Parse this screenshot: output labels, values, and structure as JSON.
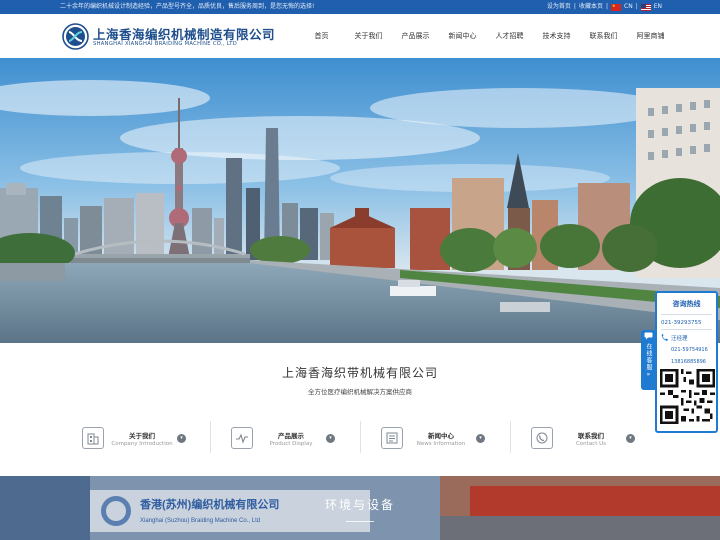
{
  "topbar": {
    "slogan": "二十余年的编织机械设计制造经验，产品型号齐全，品质优良，售后服务周到，是您无悔的选择!",
    "set_home": "设为首页",
    "separator": "|",
    "favorite": "收藏本页",
    "separator2": "|",
    "lang_cn": "CN",
    "separator3": "|",
    "lang_en": "EN"
  },
  "brand": {
    "name_cn": "上海香海编织机械制造有限公司",
    "name_en": "SHANGHAI XIANGHAI BRAIDING MACHINE CO., LTD"
  },
  "nav": {
    "items": [
      {
        "label": "首页"
      },
      {
        "label": "关于我们"
      },
      {
        "label": "产品展示"
      },
      {
        "label": "新闻中心"
      },
      {
        "label": "人才招聘"
      },
      {
        "label": "技术支持"
      },
      {
        "label": "联系我们"
      },
      {
        "label": "阿里商铺"
      }
    ]
  },
  "intro": {
    "title": "上海香海织带机械有限公司",
    "subtitle": "全方位医疗编织机械解决方案供应商",
    "quick_links": [
      {
        "cn": "关于我们",
        "en": "Company Introduction",
        "icon": "building-icon"
      },
      {
        "cn": "产品展示",
        "en": "Product Display",
        "icon": "wave-icon"
      },
      {
        "cn": "新闻中心",
        "en": "News Information",
        "icon": "newspaper-icon"
      },
      {
        "cn": "联系我们",
        "en": "Contact Us",
        "icon": "phone-icon"
      }
    ]
  },
  "env": {
    "title": "环境与设备",
    "sign_text": "香港(苏州)编织机械有限公司",
    "sign_text_en": "Xianghai (Suzhou) Braiding Machine Co., Ltd"
  },
  "float": {
    "tab_label": "在线客服",
    "tab_arrow": "»",
    "title": "咨询热线",
    "phone1": "021-39293755",
    "contact_name": "汪经理",
    "phone2": "021-59754916",
    "phone3": "13816885896"
  },
  "colors": {
    "primary": "#1f5fae",
    "float_accent": "#1f7ad1"
  }
}
